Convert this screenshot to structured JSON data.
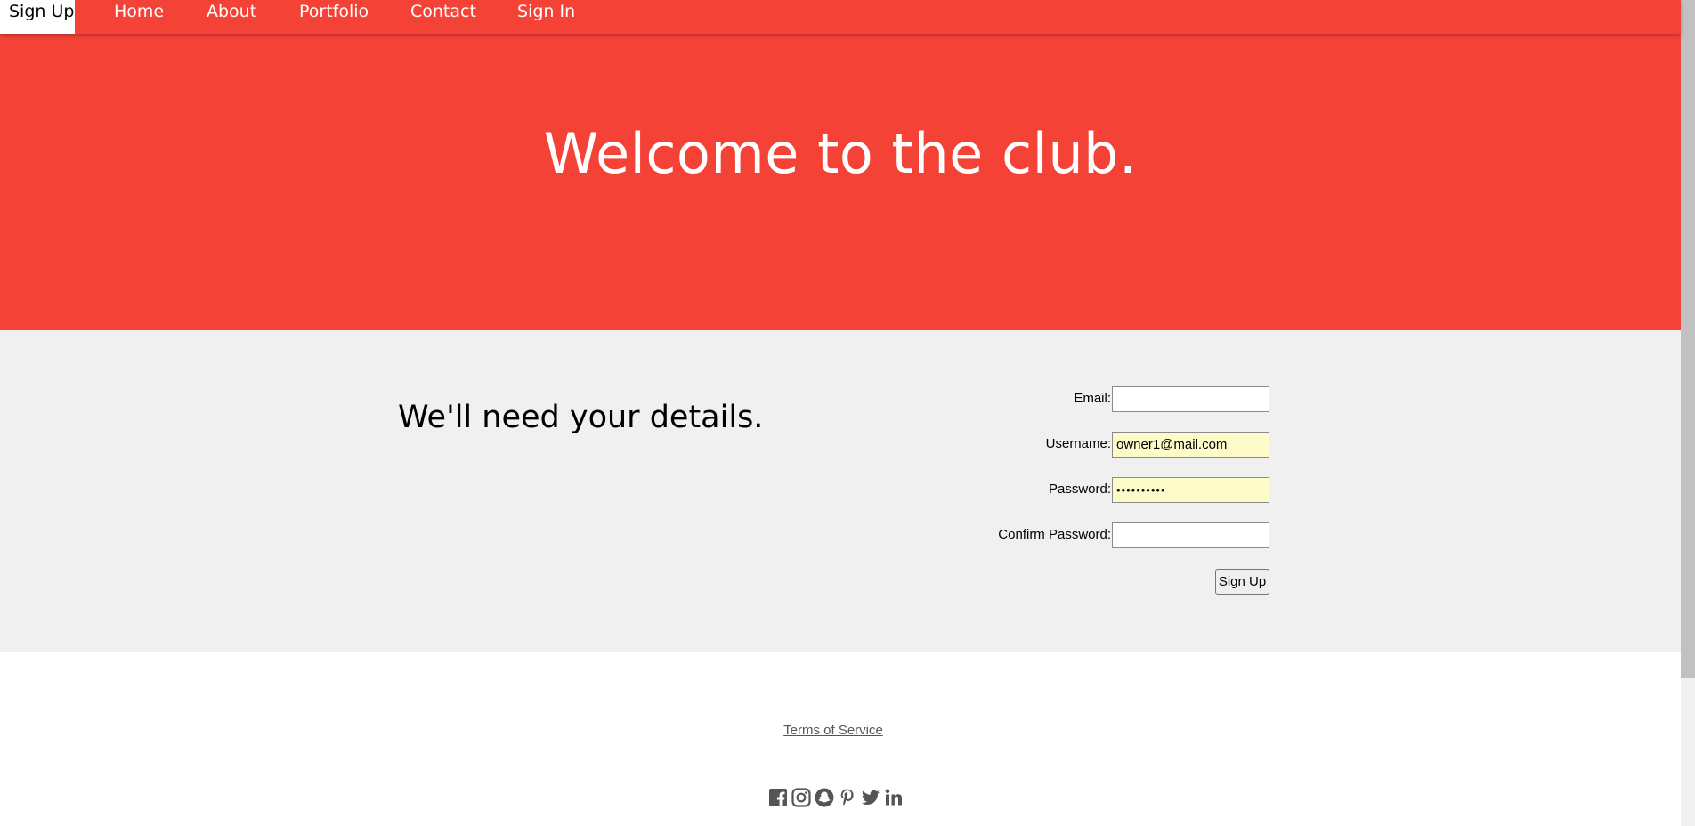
{
  "nav": {
    "items": [
      {
        "label": "Sign Up",
        "active": true
      },
      {
        "label": "Home"
      },
      {
        "label": "About"
      },
      {
        "label": "Portfolio"
      },
      {
        "label": "Contact"
      },
      {
        "label": "Sign In"
      }
    ]
  },
  "hero": {
    "title": "Welcome to the club."
  },
  "details": {
    "heading": "We'll need your details."
  },
  "form": {
    "email_label": "Email:",
    "email_value": "",
    "username_label": "Username:",
    "username_value": "owner1@mail.com",
    "password_label": "Password:",
    "password_value": "••••••••••",
    "confirm_label": "Confirm Password:",
    "confirm_value": "",
    "submit_label": "Sign Up"
  },
  "footer": {
    "tos_label": "Terms of Service",
    "social_icons": [
      "facebook-icon",
      "instagram-icon",
      "snapchat-icon",
      "pinterest-icon",
      "twitter-icon",
      "linkedin-icon"
    ]
  },
  "colors": {
    "brand": "#f44336",
    "section_bg": "#f0f0f0",
    "autofill_bg": "#fdfbc8",
    "icon": "#555555"
  }
}
